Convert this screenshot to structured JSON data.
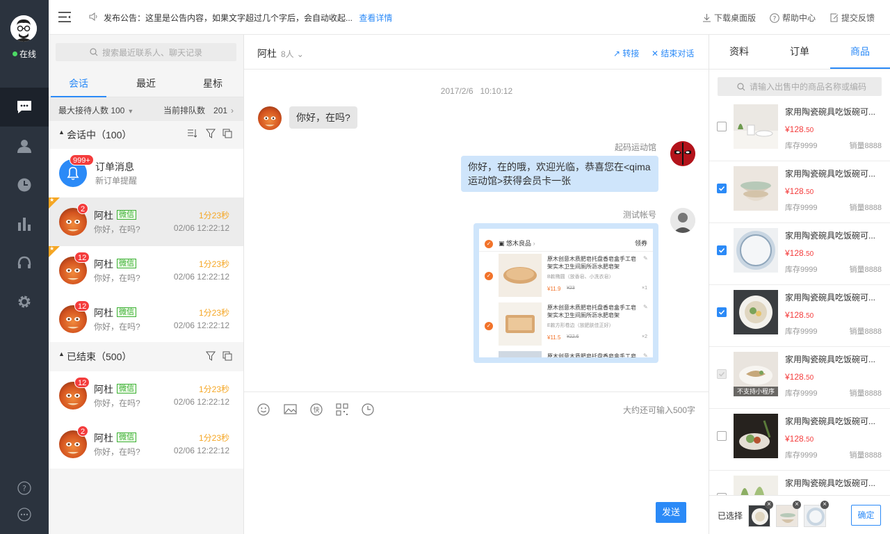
{
  "nav": {
    "status": "在线"
  },
  "topbar": {
    "notice_label": "发布公告：",
    "notice_text": "这里是公告内容，如果文字超过几个字后，会自动收起...",
    "notice_link": "查看详情",
    "download": "下载桌面版",
    "help": "帮助中心",
    "feedback": "提交反馈"
  },
  "contacts": {
    "search_placeholder": "搜索最近联系人、聊天记录",
    "tabs": [
      "会话",
      "最近",
      "星标"
    ],
    "max_reception": "最大接待人数 100",
    "queue_label": "当前排队数",
    "queue_count": "201",
    "active_section": "会话中（100）",
    "ended_section": "已结束（500）",
    "order_title": "订单消息",
    "order_sub": "新订单提醒",
    "order_badge": "999+",
    "rows": [
      {
        "name": "阿杜",
        "tag": "微信",
        "time": "1分23秒",
        "msg": "你好，在吗?",
        "date": "02/06 12:22:12",
        "badge": "2"
      },
      {
        "name": "阿杜",
        "tag": "微信",
        "time": "1分23秒",
        "msg": "你好，在吗?",
        "date": "02/06 12:22:12",
        "badge": "12"
      },
      {
        "name": "阿杜",
        "tag": "微信",
        "time": "1分23秒",
        "msg": "你好，在吗?",
        "date": "02/06 12:22:12",
        "badge": "12"
      }
    ],
    "ended_rows": [
      {
        "name": "阿杜",
        "tag": "微信",
        "time": "1分23秒",
        "msg": "你好，在吗?",
        "date": "02/06 12:22:12",
        "badge": "12"
      },
      {
        "name": "阿杜",
        "tag": "微信",
        "time": "1分23秒",
        "msg": "你好，在吗?",
        "date": "02/06 12:22:12",
        "badge": "2"
      }
    ]
  },
  "chat": {
    "title": "阿杜",
    "count": "8人",
    "transfer": "转接",
    "end": "结束对话",
    "timestamp": "2017/2/6   10:10:12",
    "msg1": "你好，在吗?",
    "sender2": "起码运动馆",
    "msg2": "你好，在的哦，欢迎光临，恭喜您在<qima运动馆>获得会员卡一张",
    "sender3": "测试帐号",
    "card": {
      "shop": "悠木良品",
      "coupon": "领券",
      "item_title": "原木创意木质肥皂托盘香皂盒手工皂架实木卫生间厕所沥水肥皂架",
      "item1_spec": "B款椭圆（放香皂、小洗衣皂）",
      "item1_price": "¥11.9",
      "item1_orig": "¥23",
      "item1_qty": "×1",
      "item2_spec": "E款方形卷边（放肥肤佳正好）",
      "item2_price": "¥11.5",
      "item2_orig": "¥22.6",
      "item2_qty": "×2"
    },
    "remaining": "大约还可输入500字",
    "send": "发送"
  },
  "products": {
    "tabs": [
      "资料",
      "订单",
      "商品"
    ],
    "search_placeholder": "请输入出售中的商品名称或编码",
    "items": [
      {
        "name": "家用陶瓷碗具吃饭碗可...",
        "price_main": "¥128.",
        "price_dec": "50",
        "stock": "库存9999",
        "sold": "销量8888",
        "checked": "off"
      },
      {
        "name": "家用陶瓷碗具吃饭碗可...",
        "price_main": "¥128.",
        "price_dec": "50",
        "stock": "库存9999",
        "sold": "销量8888",
        "checked": "on"
      },
      {
        "name": "家用陶瓷碗具吃饭碗可...",
        "price_main": "¥128.",
        "price_dec": "50",
        "stock": "库存9999",
        "sold": "销量8888",
        "checked": "on"
      },
      {
        "name": "家用陶瓷碗具吃饭碗可...",
        "price_main": "¥128.",
        "price_dec": "50",
        "stock": "库存9999",
        "sold": "销量8888",
        "checked": "on"
      },
      {
        "name": "家用陶瓷碗具吃饭碗可...",
        "price_main": "¥128.",
        "price_dec": "50",
        "stock": "库存9999",
        "sold": "销量8888",
        "checked": "disabled",
        "overlay": "不支持小程序"
      },
      {
        "name": "家用陶瓷碗具吃饭碗可...",
        "price_main": "¥128.",
        "price_dec": "50",
        "stock": "库存9999",
        "sold": "销量8888",
        "checked": "off"
      },
      {
        "name": "家用陶瓷碗具吃饭碗可...",
        "price_main": "",
        "price_dec": "",
        "stock": "",
        "sold": "",
        "checked": "off"
      }
    ],
    "selected_label": "已选择",
    "confirm": "确定"
  },
  "colors": {
    "accent": "#2b8af7",
    "nav_bg": "#2b333e",
    "price": "#f43c3c",
    "time": "#f5a623",
    "wechat": "#3cb034"
  }
}
